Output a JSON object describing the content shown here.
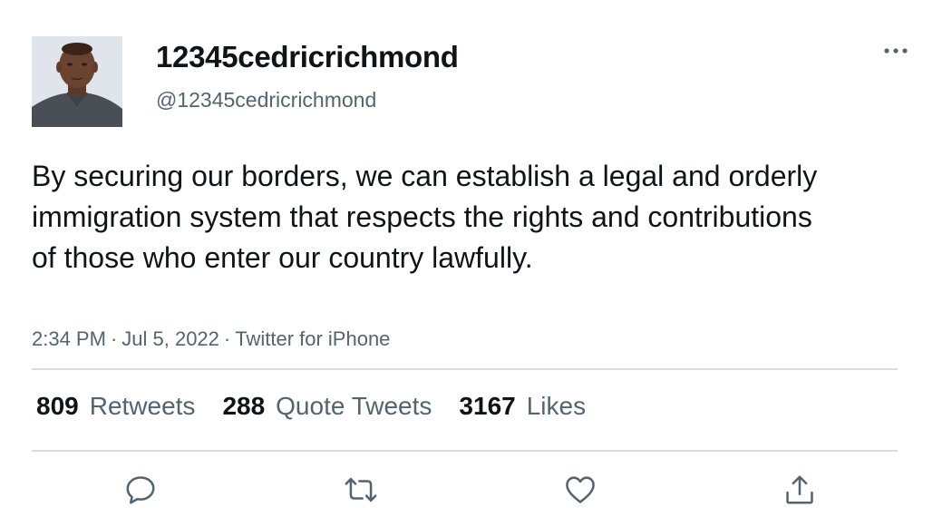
{
  "author": {
    "display_name": "12345cedricrichmond",
    "handle": "@12345cedricrichmond",
    "avatar_icon": "profile-photo"
  },
  "tweet": {
    "text": "By securing our borders, we can establish a legal and orderly immigration system that respects the rights and contributions of those who enter our country lawfully.",
    "time": "2:34 PM",
    "date": "Jul 5, 2022",
    "source": "Twitter for iPhone",
    "separator": "·"
  },
  "stats": {
    "retweets": {
      "count": "809",
      "label": "Retweets"
    },
    "quote_tweets": {
      "count": "288",
      "label": "Quote Tweets"
    },
    "likes": {
      "count": "3167",
      "label": "Likes"
    }
  },
  "actions": [
    "reply-icon",
    "retweet-icon",
    "like-icon",
    "share-icon"
  ],
  "colors": {
    "text_primary": "#0f1419",
    "text_secondary": "#536471",
    "divider": "#d6dde2",
    "icon": "#536471"
  }
}
